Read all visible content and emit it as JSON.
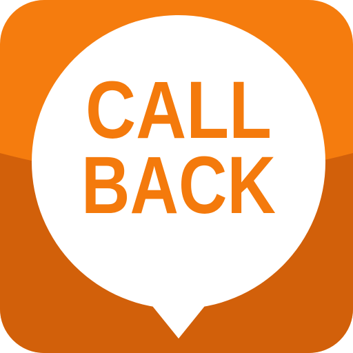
{
  "app_icon": {
    "line1": "CALL",
    "line2": "BACK",
    "icon_name": "speech-bubble-icon",
    "colors": {
      "orange_top": "#F57C0E",
      "orange_bottom": "#D2600A",
      "bubble": "#FFFFFF",
      "text": "#F47A0C"
    }
  }
}
